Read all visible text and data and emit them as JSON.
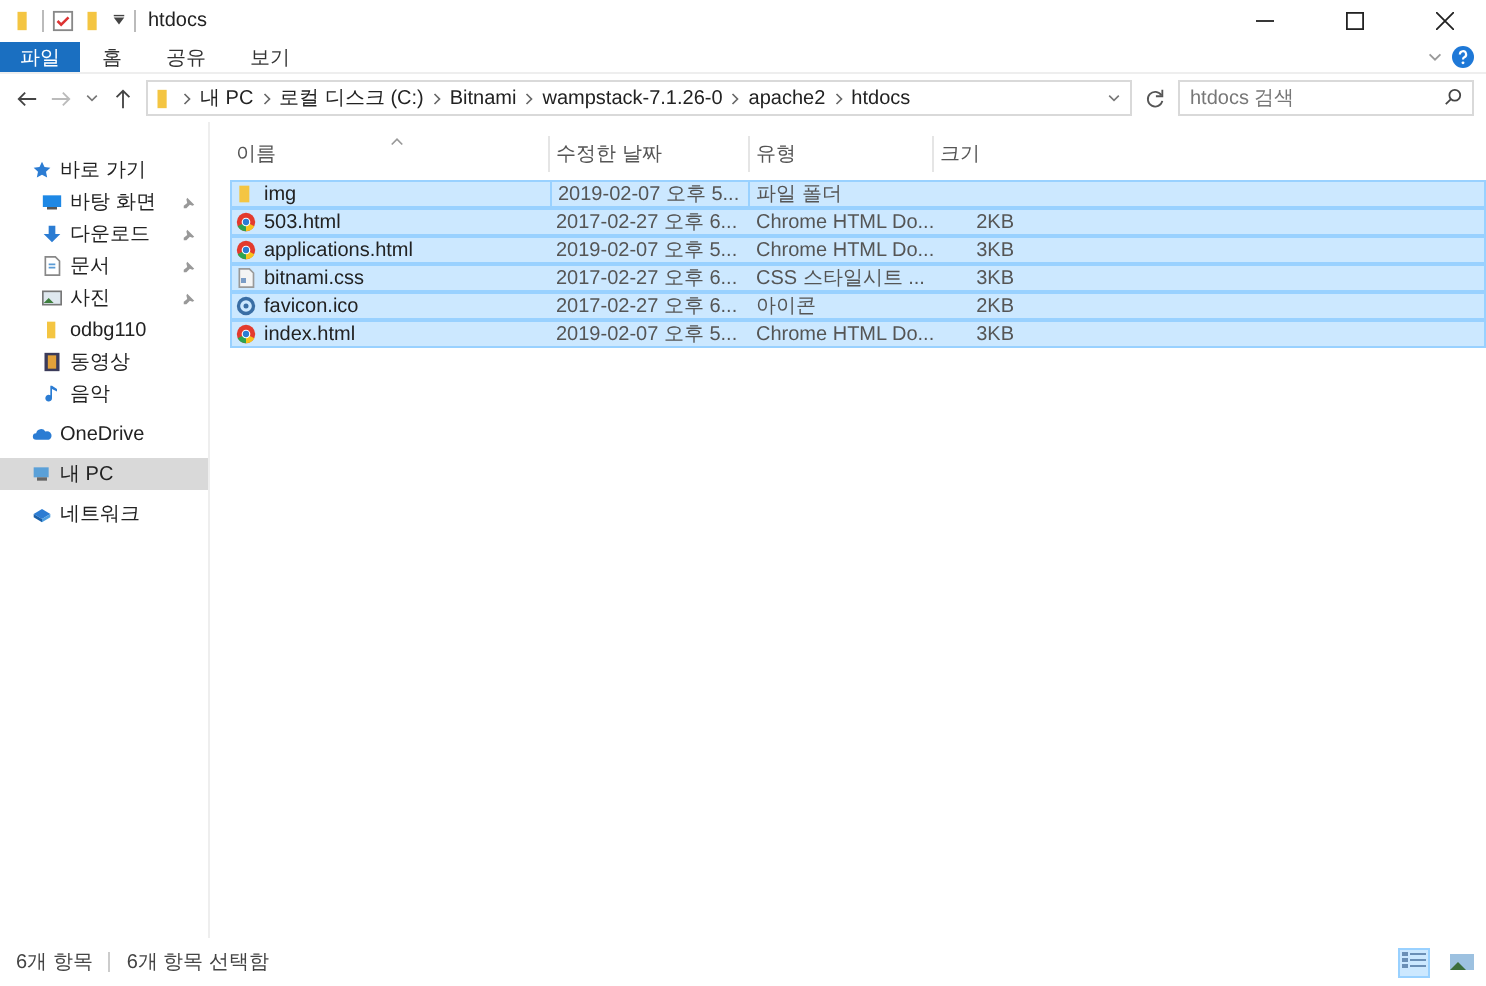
{
  "window": {
    "title": "htdocs"
  },
  "ribbon": {
    "tabs": [
      {
        "label": "파일",
        "selected": true
      },
      {
        "label": "홈",
        "selected": false
      },
      {
        "label": "공유",
        "selected": false
      },
      {
        "label": "보기",
        "selected": false
      }
    ]
  },
  "address_bar": {
    "path": [
      "내 PC",
      "로컬 디스크 (C:)",
      "Bitnami",
      "wampstack-7.1.26-0",
      "apache2",
      "htdocs"
    ]
  },
  "search": {
    "placeholder": "htdocs 검색"
  },
  "sidebar": {
    "items": [
      {
        "label": "바로 가기",
        "kind": "star",
        "pinned": false,
        "selected": false,
        "children": [
          {
            "label": "바탕 화면",
            "kind": "desktop",
            "pinned": true,
            "selected": false
          },
          {
            "label": "다운로드",
            "kind": "download",
            "pinned": true,
            "selected": false
          },
          {
            "label": "문서",
            "kind": "document",
            "pinned": true,
            "selected": false
          },
          {
            "label": "사진",
            "kind": "picture",
            "pinned": true,
            "selected": false
          },
          {
            "label": "odbg110",
            "kind": "folder",
            "pinned": false,
            "selected": false
          },
          {
            "label": "동영상",
            "kind": "video",
            "pinned": false,
            "selected": false
          },
          {
            "label": "음악",
            "kind": "music",
            "pinned": false,
            "selected": false
          }
        ]
      },
      {
        "label": "OneDrive",
        "kind": "cloud",
        "pinned": false,
        "selected": false
      },
      {
        "label": "내 PC",
        "kind": "pc",
        "pinned": false,
        "selected": true
      },
      {
        "label": "네트워크",
        "kind": "network",
        "pinned": false,
        "selected": false
      }
    ]
  },
  "columns": [
    {
      "label": "이름",
      "sorted": true
    },
    {
      "label": "수정한 날짜",
      "sorted": false
    },
    {
      "label": "유형",
      "sorted": false
    },
    {
      "label": "크기",
      "sorted": false
    }
  ],
  "files": [
    {
      "name": "img",
      "modified": "2019-02-07 오후 5...",
      "type": "파일 폴더",
      "kind": "folder",
      "selected": true,
      "focused": true
    },
    {
      "name": "503.html",
      "modified": "2017-02-27 오후 6...",
      "type": "Chrome HTML Do...",
      "size": "2KB",
      "kind": "chrome",
      "selected": true,
      "focused": false
    },
    {
      "name": "applications.html",
      "modified": "2019-02-07 오후 5...",
      "type": "Chrome HTML Do...",
      "size": "3KB",
      "kind": "chrome",
      "selected": true,
      "focused": false
    },
    {
      "name": "bitnami.css",
      "modified": "2017-02-27 오후 6...",
      "type": "CSS 스타일시트 ...",
      "size": "3KB",
      "kind": "css",
      "selected": true,
      "focused": false
    },
    {
      "name": "favicon.ico",
      "modified": "2017-02-27 오후 6...",
      "type": "아이콘",
      "size": "2KB",
      "kind": "ico",
      "selected": true,
      "focused": false
    },
    {
      "name": "index.html",
      "modified": "2019-02-07 오후 5...",
      "type": "Chrome HTML Do...",
      "size": "3KB",
      "kind": "chrome",
      "selected": true,
      "focused": false
    }
  ],
  "status_bar": {
    "count": "6개 항목",
    "selection": "6개 항목 선택함"
  },
  "view_buttons": [
    {
      "kind": "details",
      "selected": true
    },
    {
      "kind": "large-icons",
      "selected": false
    }
  ]
}
